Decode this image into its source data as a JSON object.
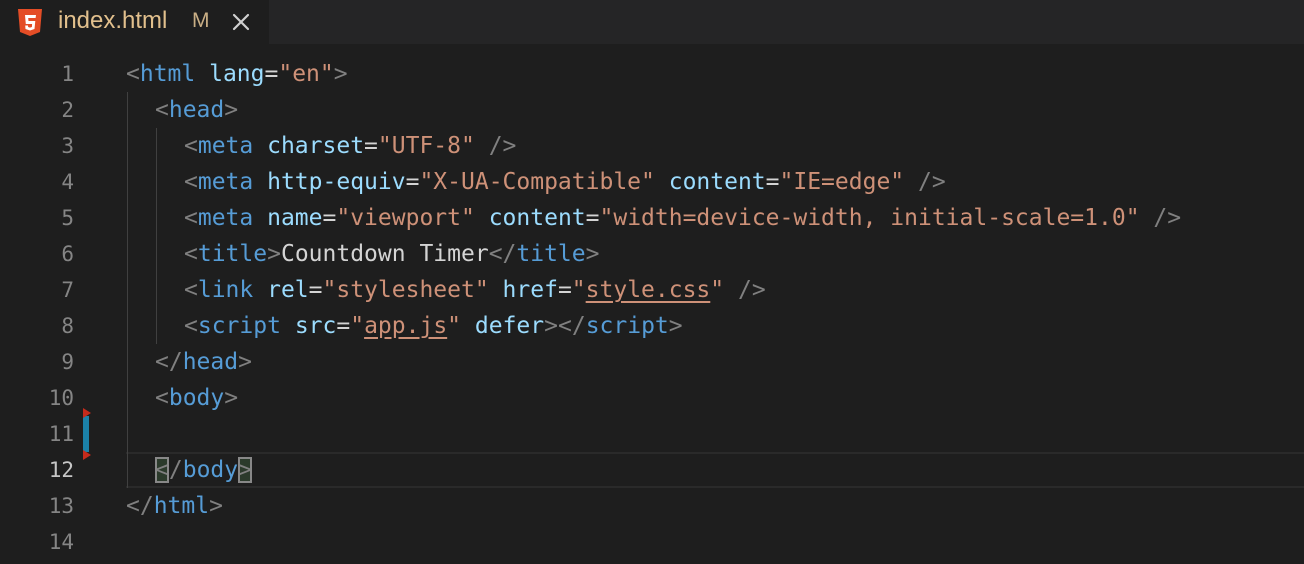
{
  "tab": {
    "icon": "html5-icon",
    "title": "index.html",
    "status": "M",
    "close_icon": "close-icon"
  },
  "editor": {
    "active_line": 12,
    "line_numbers": [
      "1",
      "2",
      "3",
      "4",
      "5",
      "6",
      "7",
      "8",
      "9",
      "10",
      "11",
      "12",
      "13",
      "14"
    ],
    "colors": {
      "background": "#1e1e1e",
      "punctuation": "#808080",
      "tag": "#569cd6",
      "attribute": "#9cdcfe",
      "string": "#ce9178",
      "text": "#d4d4d4",
      "modified_bar": "#1b81a8",
      "deleted_marker": "#c42b1c"
    },
    "lines": [
      [
        [
          "p",
          "<"
        ],
        [
          "t",
          "html"
        ],
        [
          "x",
          " "
        ],
        [
          "a",
          "lang"
        ],
        [
          "x",
          "="
        ],
        [
          "s",
          "\"en\""
        ],
        [
          "p",
          ">"
        ]
      ],
      [
        [
          "p",
          "<"
        ],
        [
          "t",
          "head"
        ],
        [
          "p",
          ">"
        ]
      ],
      [
        [
          "p",
          "<"
        ],
        [
          "t",
          "meta"
        ],
        [
          "x",
          " "
        ],
        [
          "a",
          "charset"
        ],
        [
          "x",
          "="
        ],
        [
          "s",
          "\"UTF-8\""
        ],
        [
          "x",
          " "
        ],
        [
          "p",
          "/>"
        ]
      ],
      [
        [
          "p",
          "<"
        ],
        [
          "t",
          "meta"
        ],
        [
          "x",
          " "
        ],
        [
          "a",
          "http-equiv"
        ],
        [
          "x",
          "="
        ],
        [
          "s",
          "\"X-UA-Compatible\""
        ],
        [
          "x",
          " "
        ],
        [
          "a",
          "content"
        ],
        [
          "x",
          "="
        ],
        [
          "s",
          "\"IE=edge\""
        ],
        [
          "x",
          " "
        ],
        [
          "p",
          "/>"
        ]
      ],
      [
        [
          "p",
          "<"
        ],
        [
          "t",
          "meta"
        ],
        [
          "x",
          " "
        ],
        [
          "a",
          "name"
        ],
        [
          "x",
          "="
        ],
        [
          "s",
          "\"viewport\""
        ],
        [
          "x",
          " "
        ],
        [
          "a",
          "content"
        ],
        [
          "x",
          "="
        ],
        [
          "s",
          "\"width=device-width, initial-scale=1.0\""
        ],
        [
          "x",
          " "
        ],
        [
          "p",
          "/>"
        ]
      ],
      [
        [
          "p",
          "<"
        ],
        [
          "t",
          "title"
        ],
        [
          "p",
          ">"
        ],
        [
          "x",
          "Countdown Timer"
        ],
        [
          "p",
          "</"
        ],
        [
          "t",
          "title"
        ],
        [
          "p",
          ">"
        ]
      ],
      [
        [
          "p",
          "<"
        ],
        [
          "t",
          "link"
        ],
        [
          "x",
          " "
        ],
        [
          "a",
          "rel"
        ],
        [
          "x",
          "="
        ],
        [
          "s",
          "\"stylesheet\""
        ],
        [
          "x",
          " "
        ],
        [
          "a",
          "href"
        ],
        [
          "x",
          "="
        ],
        [
          "s",
          "\""
        ],
        [
          "sl",
          "style.css"
        ],
        [
          "s",
          "\""
        ],
        [
          "x",
          " "
        ],
        [
          "p",
          "/>"
        ]
      ],
      [
        [
          "p",
          "<"
        ],
        [
          "t",
          "script"
        ],
        [
          "x",
          " "
        ],
        [
          "a",
          "src"
        ],
        [
          "x",
          "="
        ],
        [
          "s",
          "\""
        ],
        [
          "sl",
          "app.js"
        ],
        [
          "s",
          "\""
        ],
        [
          "x",
          " "
        ],
        [
          "a",
          "defer"
        ],
        [
          "p",
          "></"
        ],
        [
          "t",
          "script"
        ],
        [
          "p",
          ">"
        ]
      ],
      [
        [
          "p",
          "</"
        ],
        [
          "t",
          "head"
        ],
        [
          "p",
          ">"
        ]
      ],
      [
        [
          "p",
          "<"
        ],
        [
          "t",
          "body"
        ],
        [
          "p",
          ">"
        ]
      ],
      [],
      [
        [
          "pb",
          "<"
        ],
        [
          "p",
          "/"
        ],
        [
          "t",
          "body"
        ],
        [
          "pb",
          ">"
        ]
      ],
      [
        [
          "p",
          "</"
        ],
        [
          "t",
          "html"
        ],
        [
          "p",
          ">"
        ]
      ],
      []
    ]
  }
}
